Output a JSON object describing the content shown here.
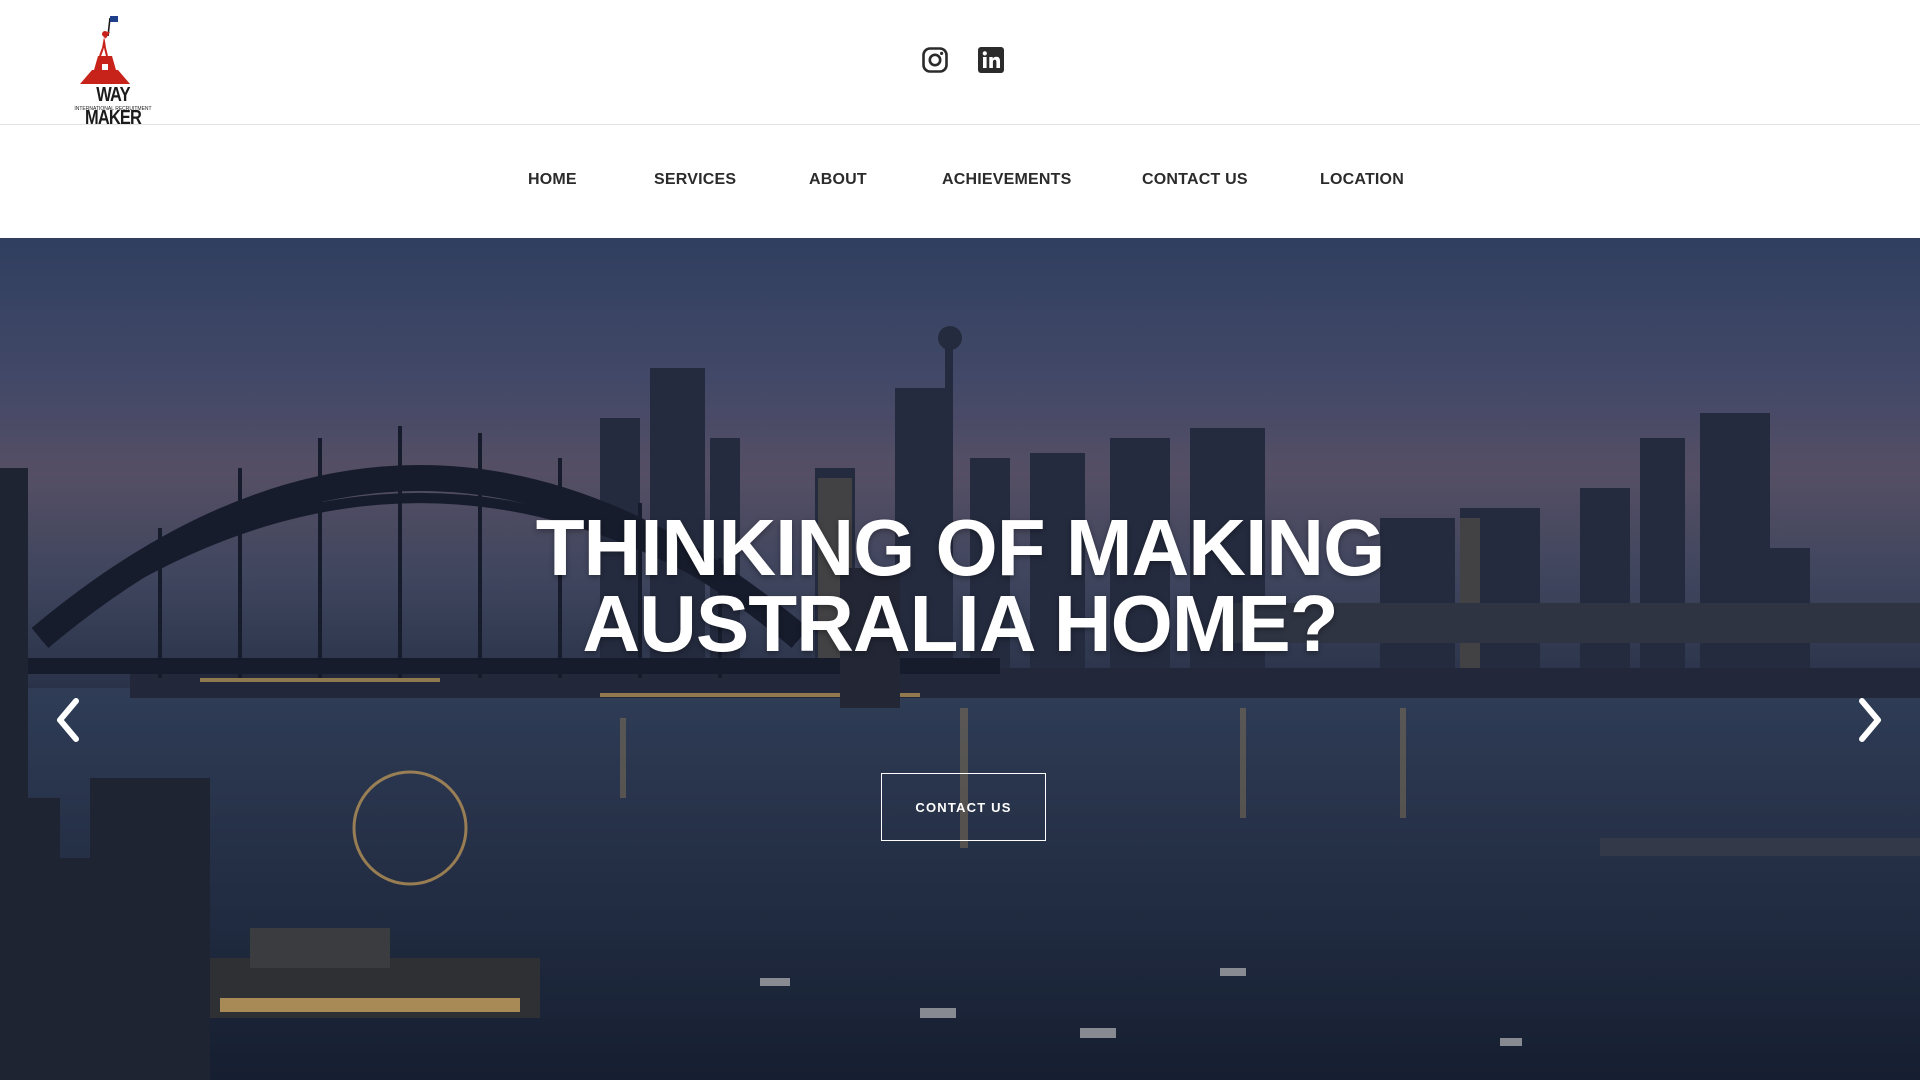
{
  "brand": {
    "name": "WAY MAKER",
    "tagline": "INTERNATIONAL RECRUITMENT",
    "colors": {
      "red": "#c8231b",
      "blue": "#1f3f8a",
      "dark": "#1b1b1b"
    }
  },
  "social": {
    "instagram_icon": "instagram-icon",
    "linkedin_icon": "linkedin-icon"
  },
  "nav": {
    "items": [
      {
        "label": "HOME"
      },
      {
        "label": "SERVICES"
      },
      {
        "label": "ABOUT"
      },
      {
        "label": "ACHIEVEMENTS"
      },
      {
        "label": "CONTACT US"
      },
      {
        "label": "LOCATION"
      }
    ]
  },
  "hero": {
    "headline_line1": "THINKING OF MAKING",
    "headline_line2": "AUSTRALIA HOME?",
    "cta_label": "CONTACT US",
    "prev_icon": "chevron-left-icon",
    "next_icon": "chevron-right-icon"
  }
}
